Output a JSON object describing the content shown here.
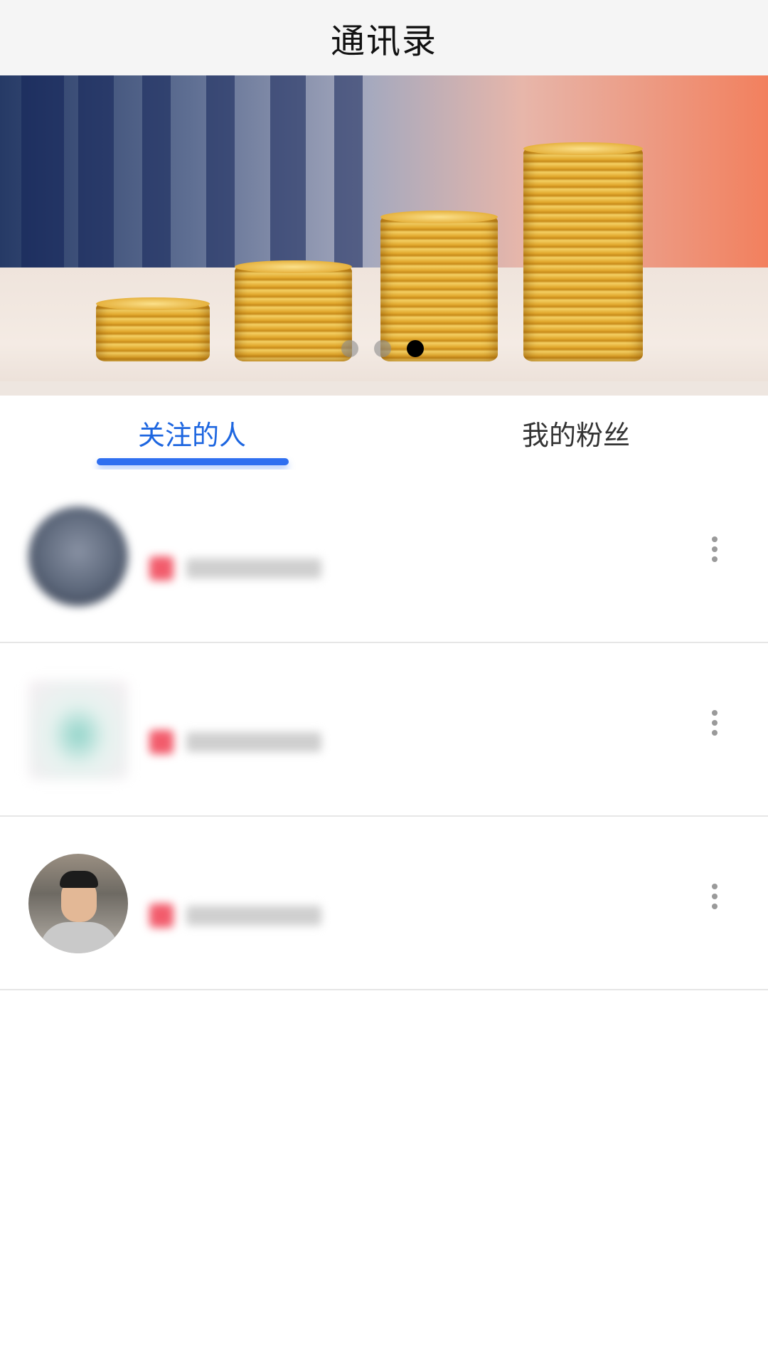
{
  "header": {
    "title": "通讯录"
  },
  "banner": {
    "slide_count": 3,
    "active_slide": 3
  },
  "tabs": [
    {
      "label": "关注的人",
      "active": true
    },
    {
      "label": "我的粉丝",
      "active": false
    }
  ],
  "contacts": [
    {
      "avatar": "blurred-avatar",
      "more_icon": "more-vertical-icon"
    },
    {
      "avatar": "blurred-avatar",
      "more_icon": "more-vertical-icon"
    },
    {
      "avatar": "photo-avatar",
      "more_icon": "more-vertical-icon"
    }
  ],
  "colors": {
    "accent": "#2f6ff0",
    "active_tab_text": "#1d66e0",
    "badge": "#f25c6c",
    "header_bg": "#f5f5f5"
  }
}
